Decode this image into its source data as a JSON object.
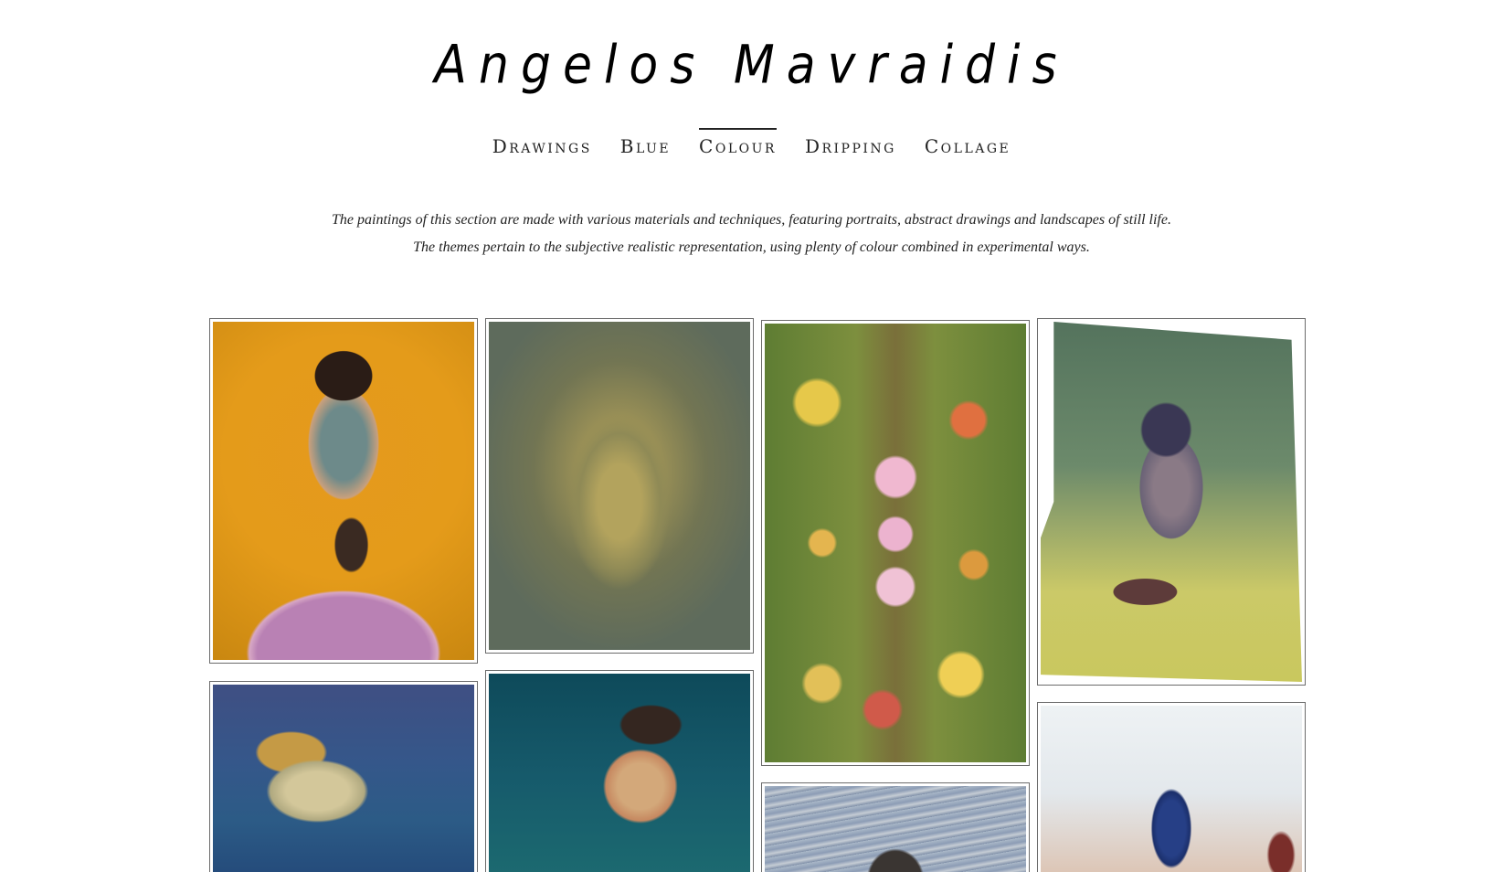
{
  "site": {
    "title": "Angelos Mavraidis"
  },
  "nav": {
    "items": [
      {
        "label": "Drawings",
        "active": false
      },
      {
        "label": "Blue",
        "active": false
      },
      {
        "label": "Colour",
        "active": true
      },
      {
        "label": "Dripping",
        "active": false
      },
      {
        "label": "Collage",
        "active": false
      }
    ]
  },
  "intro": {
    "line1": "The paintings of this section are made with various materials and techniques, featuring portraits, abstract drawings and landscapes of still life.",
    "line2": "The themes pertain to the subjective realistic representation, using plenty of colour combined in experimental ways."
  },
  "gallery": {
    "items": [
      {
        "subject": "portrait of man on orange background"
      },
      {
        "subject": "olive toned face"
      },
      {
        "subject": "flowers on green"
      },
      {
        "subject": "woman with glasses and pipe"
      },
      {
        "subject": "sleeping face in blue"
      },
      {
        "subject": "elderly woman on teal"
      },
      {
        "subject": "dog with swirling background"
      },
      {
        "subject": "blue bird"
      }
    ]
  },
  "colors": {
    "text": "#111111",
    "border": "#6b6b6b",
    "background": "#ffffff"
  }
}
